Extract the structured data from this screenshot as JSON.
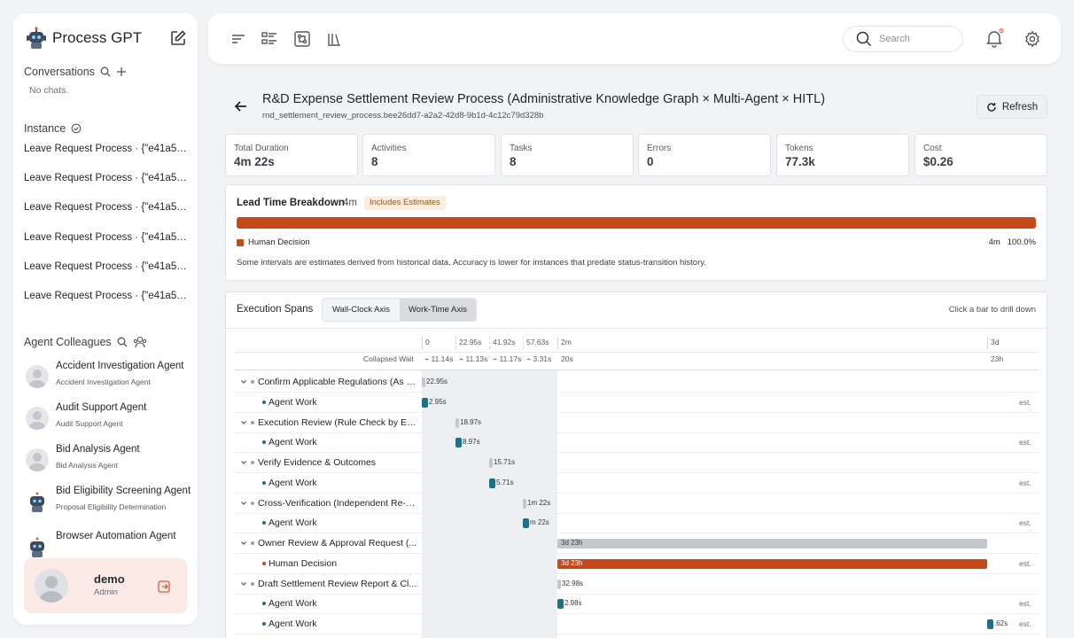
{
  "app": {
    "name": "Process GPT"
  },
  "sidebar": {
    "conversations_label": "Conversations",
    "no_chats": "No chats.",
    "instance_label": "Instance",
    "instances": [
      "Leave Request Process · {\"e41a53...",
      "Leave Request Process · {\"e41a53...",
      "Leave Request Process · {\"e41a53...",
      "Leave Request Process · {\"e41a53...",
      "Leave Request Process · {\"e41a53...",
      "Leave Request Process · {\"e41a53..."
    ],
    "agents_label": "Agent Colleagues",
    "agents": [
      {
        "name": "Accident Investigation Agent",
        "sub": "Accident Investigation Agent"
      },
      {
        "name": "Audit Support Agent",
        "sub": "Audit Support Agent"
      },
      {
        "name": "Bid Analysis Agent",
        "sub": "Bid Analysis Agent"
      },
      {
        "name": "Bid Eligibility Screening Agent",
        "sub": "Proposal Eligibility Determination"
      },
      {
        "name": "Browser Automation Agent",
        "sub": ""
      }
    ],
    "user": {
      "name": "demo",
      "role": "Admin"
    }
  },
  "topbar": {
    "search_placeholder": "Search"
  },
  "page": {
    "title": "R&D Expense Settlement Review Process (Administrative Knowledge Graph × Multi-Agent × HITL)",
    "id": "rnd_settlement_review_process.bee26dd7-a2a2-42d8-9b1d-4c12c79d328b",
    "refresh_label": "Refresh"
  },
  "stats": [
    {
      "label": "Total Duration",
      "value": "4m 22s"
    },
    {
      "label": "Activities",
      "value": "8"
    },
    {
      "label": "Tasks",
      "value": "8"
    },
    {
      "label": "Errors",
      "value": "0"
    },
    {
      "label": "Tokens",
      "value": "77.3k"
    },
    {
      "label": "Cost",
      "value": "$0.26"
    }
  ],
  "lead_time": {
    "title": "Lead Time Breakdown",
    "duration": "4m",
    "badge": "Includes Estimates",
    "legend": "Human Decision",
    "right_value": "4m",
    "right_pct": "100.0%",
    "note": "Some intervals are estimates derived from historical data. Accuracy is lower for instances that predate status-transition history."
  },
  "spans": {
    "title": "Execution Spans",
    "tab_wall": "Wall-Clock Axis",
    "tab_work": "Work-Time Axis",
    "hint": "Click a bar to drill down",
    "collapsed_label": "Collapsed Wait",
    "axis_ticks": [
      "0",
      "22.95s",
      "41.92s",
      "57.63s",
      "2m",
      "3d"
    ],
    "wait_labels": [
      "11.14s",
      "11.13s",
      "11.17s",
      "3.31s",
      "20s",
      "23h"
    ],
    "est_label": "est.",
    "rows": [
      {
        "label": "Confirm Applicable Regulations (As o...",
        "bar": "22.95s"
      },
      {
        "label": "Agent Work",
        "bar": "2.95s"
      },
      {
        "label": "Execution Review (Rule Check by Ex...",
        "bar": "18.97s"
      },
      {
        "label": "Agent Work",
        "bar": "8.97s"
      },
      {
        "label": "Verify Evidence & Outcomes",
        "bar": "15.71s"
      },
      {
        "label": "Agent Work",
        "bar": "5.71s"
      },
      {
        "label": "Cross-Verification (Independent Re-J...",
        "bar": "1m 22s"
      },
      {
        "label": "Agent Work",
        "bar": "m 22s"
      },
      {
        "label": "Owner Review & Approval Request (...",
        "bar": "3d 23h"
      },
      {
        "label": "Human Decision",
        "bar": "3d 23h"
      },
      {
        "label": "Draft Settlement Review Report & Cl...",
        "bar": "32.98s"
      },
      {
        "label": "Agent Work",
        "bar": "2.98s"
      },
      {
        "label": "Agent Work",
        "bar": ".62s"
      }
    ]
  },
  "colors": {
    "accent": "#c6491a",
    "agent_bar": "#1f6f87",
    "parent_bar": "#c3c6cb"
  }
}
